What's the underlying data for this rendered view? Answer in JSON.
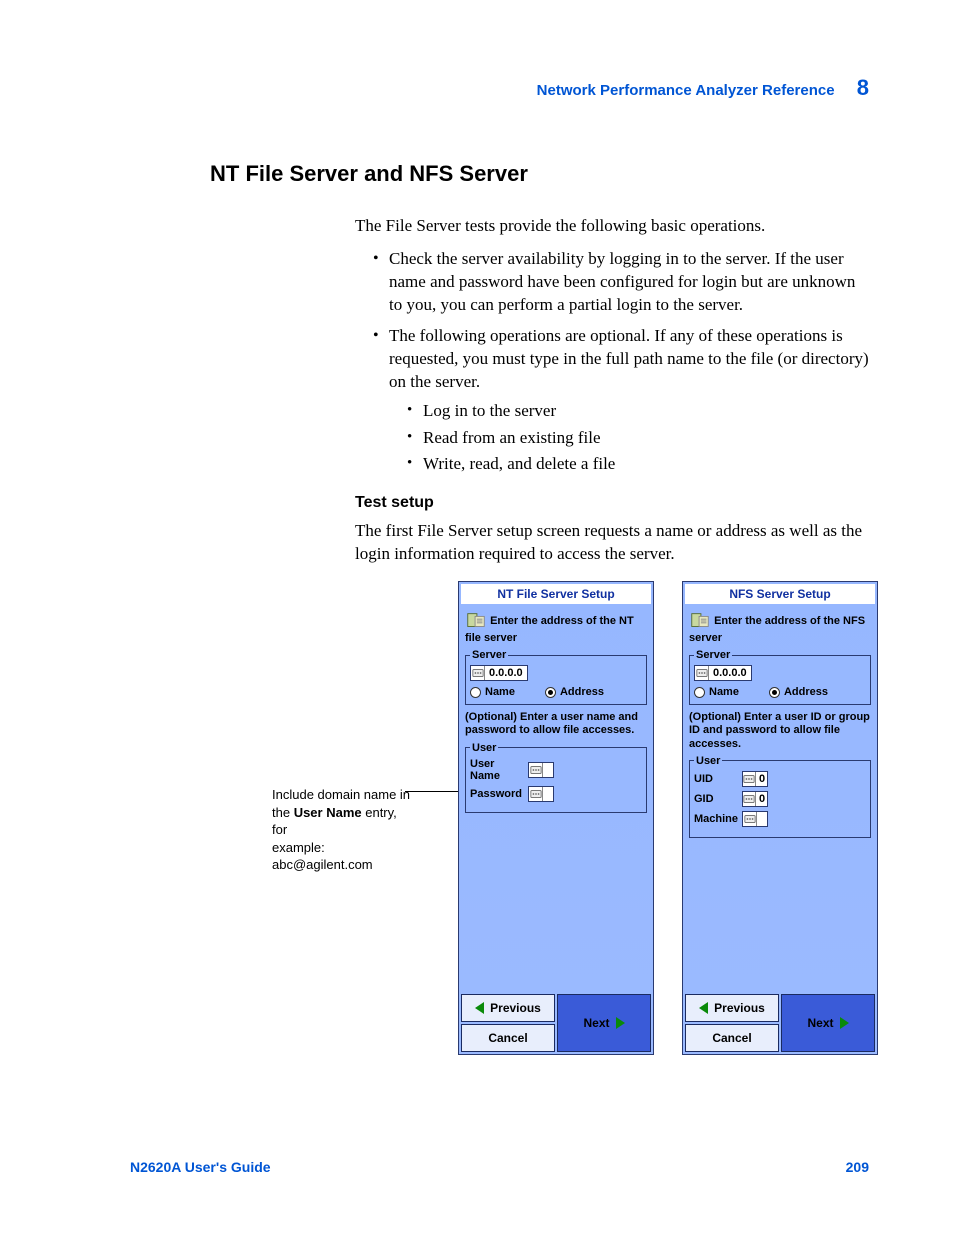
{
  "header": {
    "title": "Network Performance Analyzer Reference",
    "chapter": "8"
  },
  "section_title": "NT File Server and NFS Server",
  "intro": "The File Server tests provide the following basic operations.",
  "bullets": [
    "Check the server availability by logging in to the server. If the user name and password have been configured for login but are unknown to you, you can perform a partial login to the server.",
    "The following operations are optional. If any of these operations is requested, you must type in the full path name to the file (or directory) on the server."
  ],
  "sub_bullets": [
    "Log in to the server",
    "Read from an existing file",
    "Write, read, and delete a file"
  ],
  "test_setup": {
    "heading": "Test setup",
    "text": "The first File Server setup screen requests a name or address as well as the login information required to access the server."
  },
  "callout": {
    "line1": "Include domain name in",
    "line2a": "the ",
    "line2b": "User Name",
    "line2c": " entry, for",
    "line3": "example:",
    "line4": "abc@agilent.com"
  },
  "nt_panel": {
    "title": "NT File Server Setup",
    "instruction": "Enter the address of the NT file server",
    "server_legend": "Server",
    "server_value": "0.0.0.0",
    "radio_name": "Name",
    "radio_address": "Address",
    "radio_selected": "Address",
    "optional_text": "(Optional) Enter a user name and password to allow file accesses.",
    "user_legend": "User",
    "fields": [
      {
        "label": "User Name",
        "value": ""
      },
      {
        "label": "Password",
        "value": ""
      }
    ]
  },
  "nfs_panel": {
    "title": "NFS Server Setup",
    "instruction": "Enter the address of the NFS server",
    "server_legend": "Server",
    "server_value": "0.0.0.0",
    "radio_name": "Name",
    "radio_address": "Address",
    "radio_selected": "Address",
    "optional_text": "(Optional) Enter a user ID or group ID and password to allow file accesses.",
    "user_legend": "User",
    "fields": [
      {
        "label": "UID",
        "value": "0"
      },
      {
        "label": "GID",
        "value": "0"
      },
      {
        "label": "Machine",
        "value": ""
      }
    ]
  },
  "nav": {
    "previous": "Previous",
    "cancel": "Cancel",
    "next": "Next"
  },
  "footer": {
    "guide": "N2620A User's Guide",
    "page": "209"
  }
}
